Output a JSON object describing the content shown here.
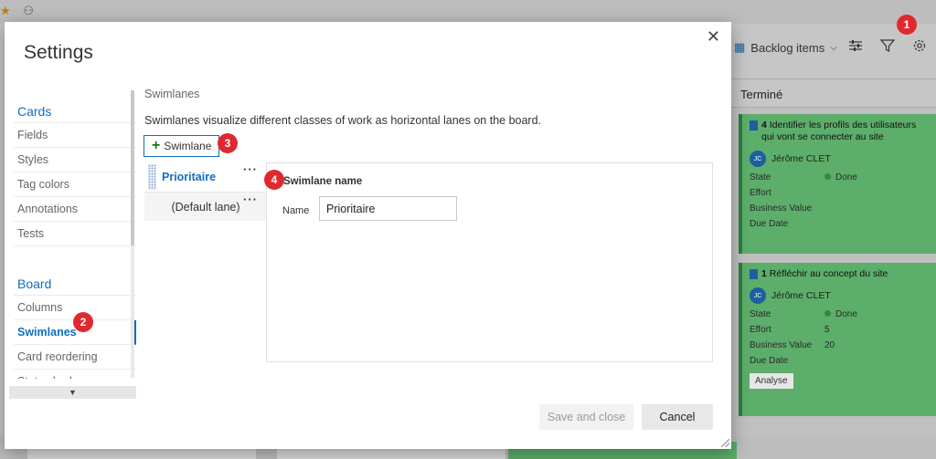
{
  "background": {
    "backlog_selector": "Backlog items",
    "column_title": "Terminé",
    "cards": [
      {
        "id": "4",
        "title": "Identifier les profils des utilisateurs qui vont se connecter au site",
        "avatar_initials": "JC",
        "assignee": "Jérôme CLET",
        "fields": [
          {
            "key": "State",
            "value": "Done"
          },
          {
            "key": "Effort",
            "value": ""
          },
          {
            "key": "Business Value",
            "value": ""
          },
          {
            "key": "Due Date",
            "value": ""
          }
        ]
      },
      {
        "id": "1",
        "title": "Réfléchir au concept du site",
        "avatar_initials": "JC",
        "assignee": "Jérôme CLET",
        "fields": [
          {
            "key": "State",
            "value": "Done"
          },
          {
            "key": "Effort",
            "value": "5"
          },
          {
            "key": "Business Value",
            "value": "20"
          },
          {
            "key": "Due Date",
            "value": ""
          }
        ],
        "tag": "Analyse"
      }
    ]
  },
  "badges": {
    "b1": "1",
    "b2": "2",
    "b3": "3",
    "b4": "4"
  },
  "dialog": {
    "title": "Settings",
    "close_glyph": "✕",
    "nav": {
      "cards_section": "Cards",
      "cards_items": [
        "Fields",
        "Styles",
        "Tag colors",
        "Annotations",
        "Tests"
      ],
      "board_section": "Board",
      "board_items": [
        "Columns",
        "Swimlanes",
        "Card reordering",
        "Status badge"
      ]
    },
    "content": {
      "section_title": "Swimlanes",
      "description": "Swimlanes visualize different classes of work as horizontal lanes on the board.",
      "add_label": "Swimlane",
      "lanes": [
        "Prioritaire",
        "(Default lane)"
      ],
      "detail_title": "Swimlane name",
      "name_label": "Name",
      "name_value": "Prioritaire"
    },
    "buttons": {
      "save": "Save and close",
      "cancel": "Cancel"
    }
  },
  "colors": {
    "accent": "#106ebe",
    "badge": "#e0292f",
    "card_green": "#5cae6a",
    "add_plus": "#107c10"
  }
}
